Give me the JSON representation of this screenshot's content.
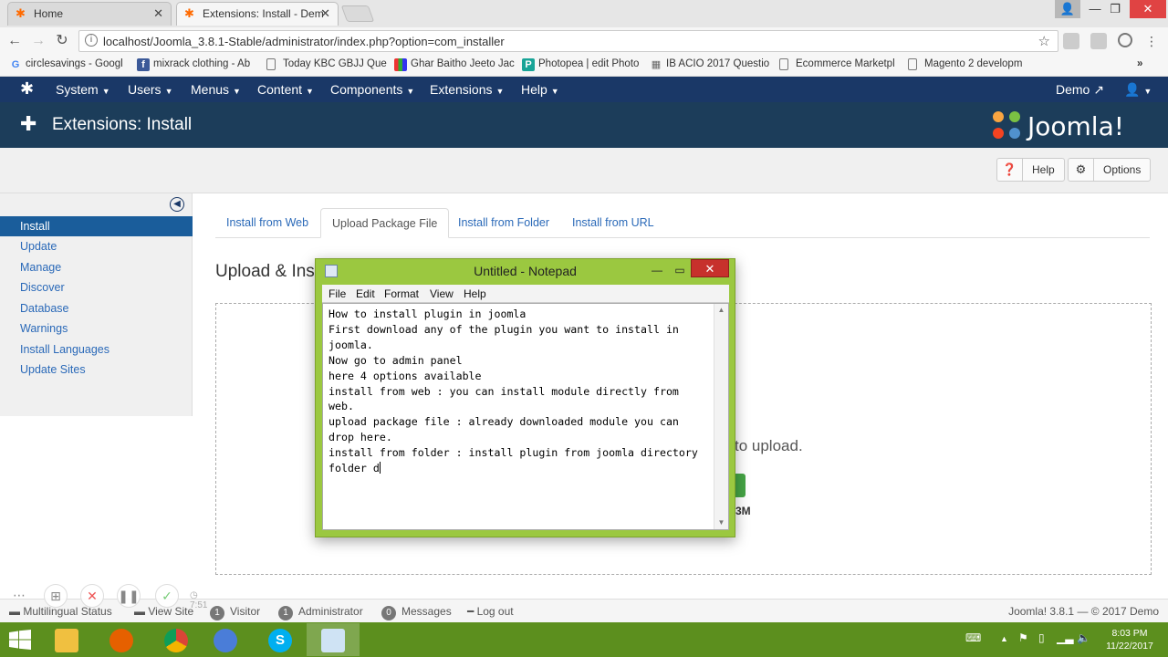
{
  "browser": {
    "tabs": [
      {
        "label": "Home"
      },
      {
        "label": "Extensions: Install - Dem"
      }
    ],
    "url": "localhost/Joomla_3.8.1-Stable/administrator/index.php?option=com_installer",
    "bookmarks": [
      {
        "label": "circlesavings - Googl"
      },
      {
        "label": "mixrack clothing - Ab"
      },
      {
        "label": "Today KBC GBJJ Que"
      },
      {
        "label": "Ghar Baitho Jeeto Jac"
      },
      {
        "label": "Photopea | edit Photo"
      },
      {
        "label": "IB ACIO 2017 Questio"
      },
      {
        "label": "Ecommerce Marketpl"
      },
      {
        "label": "Magento 2 developm"
      }
    ]
  },
  "joomla": {
    "nav": [
      {
        "label": "System"
      },
      {
        "label": "Users"
      },
      {
        "label": "Menus"
      },
      {
        "label": "Content"
      },
      {
        "label": "Components"
      },
      {
        "label": "Extensions"
      },
      {
        "label": "Help"
      }
    ],
    "demo_label": "Demo",
    "page_title": "Extensions: Install",
    "brand": "Joomla!",
    "toolbar": {
      "help": "Help",
      "options": "Options"
    },
    "sidebar": [
      {
        "label": "Install"
      },
      {
        "label": "Update"
      },
      {
        "label": "Manage"
      },
      {
        "label": "Discover"
      },
      {
        "label": "Database"
      },
      {
        "label": "Warnings"
      },
      {
        "label": "Install Languages"
      },
      {
        "label": "Update Sites"
      }
    ],
    "tabs": [
      {
        "label": "Install from Web"
      },
      {
        "label": "Upload Package File"
      },
      {
        "label": "Install from Folder"
      },
      {
        "label": "Install from URL"
      }
    ],
    "upload_title": "Upload & Inst",
    "drop_text": "to upload.",
    "size_text": "3M",
    "status": {
      "multilingual": "Multilingual Status",
      "view_site": "View Site",
      "visitor_count": "1",
      "visitor": "Visitor",
      "admin_count": "1",
      "admin": "Administrator",
      "messages_count": "0",
      "messages": "Messages",
      "logout": "Log out",
      "version": "Joomla! 3.8.1 — © 2017 Demo"
    }
  },
  "recorder": {
    "time": "7:51"
  },
  "notepad": {
    "title": "Untitled - Notepad",
    "menu": [
      "File",
      "Edit",
      "Format",
      "View",
      "Help"
    ],
    "text": "How to install plugin in joomla\nFirst download any of the plugin you want to install in joomla.\nNow go to admin panel\nhere 4 options available\ninstall from web : you can install module directly from web.\nupload package file : already downloaded module you can drop here.\ninstall from folder : install plugin from joomla directory folder d"
  },
  "taskbar": {
    "time": "8:03 PM",
    "date": "11/22/2017"
  }
}
